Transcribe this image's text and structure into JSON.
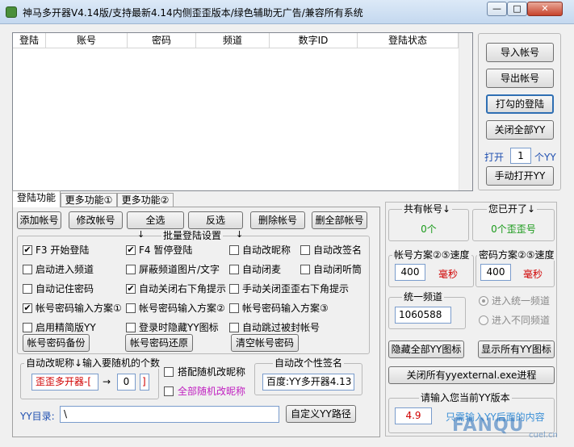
{
  "window": {
    "title": "神马多开器V4.14版/支持最新4.14内侧歪歪版本/绿色辅助无广告/兼容所有系统",
    "minimize": "—",
    "maximize": "□",
    "close": "✕"
  },
  "table": {
    "columns": [
      "登陆",
      "账号",
      "密码",
      "频道",
      "数字ID",
      "登陆状态"
    ]
  },
  "right_panel": {
    "import": "导入帐号",
    "export": "导出帐号",
    "login_checked": "打勾的登陆",
    "close_all": "关闭全部YY",
    "open_label": "打开",
    "open_count": "1",
    "open_unit": "个YY",
    "manual_open": "手动打开YY"
  },
  "tabs": [
    "登陆功能",
    "更多功能①",
    "更多功能②"
  ],
  "toolbar": {
    "add": "添加帐号",
    "edit": "修改帐号",
    "select_all": "全选",
    "invert": "反选",
    "delete": "删除帐号",
    "delete_all": "删全部帐号"
  },
  "batch": {
    "title": "批量登陆设置",
    "options": [
      {
        "label": "F3 开始登陆",
        "checked": true
      },
      {
        "label": "F4 暂停登陆",
        "checked": true
      },
      {
        "label": "自动改昵称",
        "checked": false
      },
      {
        "label": "自动改签名",
        "checked": false
      },
      {
        "label": "启动进入频道",
        "checked": false
      },
      {
        "label": "屏蔽频道图片/文字",
        "checked": false
      },
      {
        "label": "自动闭麦",
        "checked": false
      },
      {
        "label": "自动闭听筒",
        "checked": false
      },
      {
        "label": "自动记住密码",
        "checked": false
      },
      {
        "label": "自动关闭右下角提示",
        "checked": true
      },
      {
        "label": "手动关闭歪歪右下角提示",
        "checked": false
      },
      {
        "label": "帐号密码输入方案①",
        "checked": true
      },
      {
        "label": "帐号密码输入方案②",
        "checked": false
      },
      {
        "label": "帐号密码输入方案③",
        "checked": false
      },
      {
        "label": "启用精简版YY",
        "checked": false
      },
      {
        "label": "登录时隐藏YY图标",
        "checked": false
      },
      {
        "label": "自动跳过被封帐号",
        "checked": false
      }
    ],
    "backup": "帐号密码备份",
    "restore": "帐号密码还原",
    "clear": "清空帐号密码"
  },
  "nickname": {
    "title": "自动改昵称↓输入要随机的个数",
    "value": "歪歪多开器-[",
    "arrow": "→",
    "count": "0",
    "bracket": "]",
    "random_some": "搭配随机改昵称",
    "random_all": "全部随机改昵称"
  },
  "signature": {
    "title": "自动改个性签名",
    "value": "百度:YY多开器4.13"
  },
  "yy_dir": {
    "label": "YY目录:",
    "value": "\\",
    "button": "自定义YY路径"
  },
  "stats": {
    "total_label": "共有帐号↓",
    "total_value": "0个",
    "opened_label": "您已开了↓",
    "opened_value": "0个歪歪号"
  },
  "speed": {
    "account_label": "帐号方案②⑤速度",
    "account_value": "400",
    "account_unit": "毫秒",
    "password_label": "密码方案②⑤速度",
    "password_value": "400",
    "password_unit": "毫秒"
  },
  "channel": {
    "title": "统一频道",
    "value": "1060588",
    "radio_same": "进入统一频道",
    "radio_diff": "进入不同频道"
  },
  "bottom_right": {
    "hide_icons": "隐藏全部YY图标",
    "show_icons": "显示所有YY图标",
    "close_external": "关闭所有yyexternal.exe进程",
    "version_title": "请输入您当前YY版本",
    "version_value": "4.9",
    "version_hint": "只需输入YY后面的内容"
  },
  "watermark": {
    "text": "FANQU",
    "sub": "cuel.cn"
  },
  "colors": {
    "red": "#d00000",
    "green": "#1a9a1a",
    "purple": "#c020c0",
    "blue_hint": "#3a8fd6"
  }
}
